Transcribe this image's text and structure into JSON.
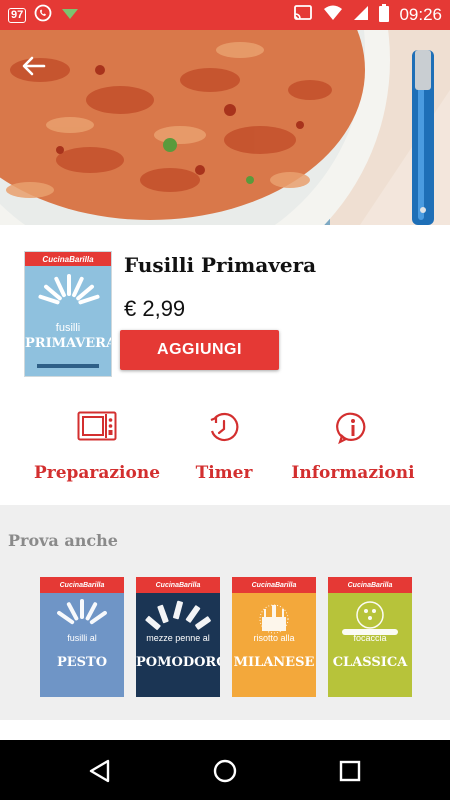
{
  "status_bar": {
    "notification_badge": "97",
    "time": "09:26",
    "icons": [
      "notification-badge-icon",
      "whatsapp-icon",
      "download-icon",
      "cast-icon",
      "wifi-icon",
      "signal-icon",
      "battery-icon"
    ]
  },
  "hero": {
    "image": "pasta-dish-photo"
  },
  "product": {
    "title": "Fusilli Primavera",
    "price": "€ 2,99",
    "add_label": "AGGIUNGI",
    "box": {
      "brand": "CucinaBarilla",
      "name_line1": "fusilli",
      "name_line2": "PRIMAVERA"
    }
  },
  "actions": [
    {
      "label": "Preparazione",
      "icon": "microwave-icon"
    },
    {
      "label": "Timer",
      "icon": "timer-icon"
    },
    {
      "label": "Informazioni",
      "icon": "info-icon"
    }
  ],
  "also_try": {
    "title": "Prova anche",
    "items": [
      {
        "brand": "CucinaBarilla",
        "line1": "fusilli al",
        "line2": "PESTO",
        "color": "#6f95c6"
      },
      {
        "brand": "CucinaBarilla",
        "line1": "mezze penne al",
        "line2": "POMODORO",
        "color": "#1b3554"
      },
      {
        "brand": "CucinaBarilla",
        "line1": "risotto alla",
        "line2": "MILANESE",
        "color": "#f3a83b"
      },
      {
        "brand": "CucinaBarilla",
        "line1": "focaccia",
        "line2": "CLASSICA",
        "color": "#b7c33a"
      }
    ]
  },
  "colors": {
    "accent": "#e53935",
    "action_text": "#d32f2f",
    "section_bg": "#efefef"
  }
}
